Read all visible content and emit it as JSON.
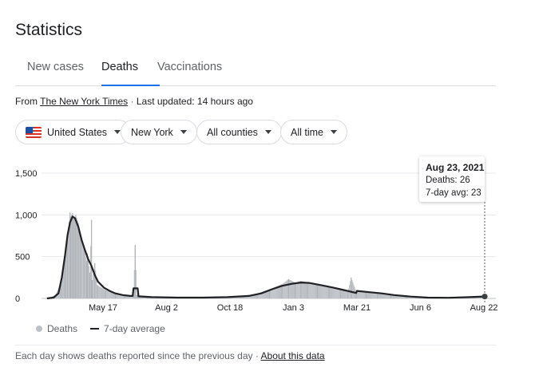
{
  "title": "Statistics",
  "tabs": [
    {
      "label": "New cases",
      "active": false
    },
    {
      "label": "Deaths",
      "active": true
    },
    {
      "label": "Vaccinations",
      "active": false
    }
  ],
  "source": {
    "prefix": "From",
    "link": "The New York Times",
    "separator": "·",
    "updated": "Last updated: 14 hours ago"
  },
  "filters": [
    {
      "label": "United States",
      "icon": "us-flag-icon"
    },
    {
      "label": "New York"
    },
    {
      "label": "All counties"
    },
    {
      "label": "All time"
    }
  ],
  "colors": {
    "accent": "#1a73e8",
    "bars": "#bdc1c6",
    "avg_line": "#202124"
  },
  "chart_data": {
    "type": "bar",
    "title": "",
    "ylim": [
      0,
      1500
    ],
    "yticks": [
      {
        "value": 0,
        "label": "0"
      },
      {
        "value": 500,
        "label": "500"
      },
      {
        "value": 1000,
        "label": "1,000"
      },
      {
        "value": 1500,
        "label": "1,500"
      }
    ],
    "xrange": [
      "2020-03-01",
      "2021-08-23"
    ],
    "xticks": [
      {
        "date": "2020-05-17",
        "label": "May 17"
      },
      {
        "date": "2020-08-02",
        "label": "Aug 2"
      },
      {
        "date": "2020-10-18",
        "label": "Oct 18"
      },
      {
        "date": "2021-01-03",
        "label": "Jan 3"
      },
      {
        "date": "2021-03-21",
        "label": "Mar 21"
      },
      {
        "date": "2021-06-06",
        "label": "Jun 6"
      },
      {
        "date": "2021-08-22",
        "label": "Aug 22"
      }
    ],
    "grid": "horizontal",
    "legend_position": "bottom-left",
    "legend": [
      "Deaths",
      "7-day average"
    ],
    "series": [
      {
        "name": "Deaths",
        "style": "bars",
        "points": [
          [
            "2020-03-10",
            0
          ],
          [
            "2020-03-20",
            40
          ],
          [
            "2020-03-27",
            180
          ],
          [
            "2020-04-01",
            480
          ],
          [
            "2020-04-04",
            700
          ],
          [
            "2020-04-07",
            1030
          ],
          [
            "2020-04-08",
            980
          ],
          [
            "2020-04-10",
            1020
          ],
          [
            "2020-04-12",
            960
          ],
          [
            "2020-04-14",
            1000
          ],
          [
            "2020-04-17",
            900
          ],
          [
            "2020-04-20",
            740
          ],
          [
            "2020-04-24",
            600
          ],
          [
            "2020-04-27",
            450
          ],
          [
            "2020-04-28",
            540
          ],
          [
            "2020-05-01",
            310
          ],
          [
            "2020-05-03",
            940
          ],
          [
            "2020-05-04",
            220
          ],
          [
            "2020-05-07",
            420
          ],
          [
            "2020-05-10",
            160
          ],
          [
            "2020-05-20",
            100
          ],
          [
            "2020-06-01",
            60
          ],
          [
            "2020-06-12",
            30
          ],
          [
            "2020-06-23",
            40
          ],
          [
            "2020-06-25",
            640
          ],
          [
            "2020-06-27",
            40
          ],
          [
            "2020-07-10",
            15
          ],
          [
            "2020-08-01",
            10
          ],
          [
            "2020-09-01",
            10
          ],
          [
            "2020-10-01",
            12
          ],
          [
            "2020-11-01",
            25
          ],
          [
            "2020-11-20",
            60
          ],
          [
            "2020-12-05",
            110
          ],
          [
            "2020-12-20",
            170
          ],
          [
            "2020-12-28",
            230
          ],
          [
            "2021-01-05",
            190
          ],
          [
            "2021-01-12",
            210
          ],
          [
            "2021-01-20",
            195
          ],
          [
            "2021-02-01",
            175
          ],
          [
            "2021-02-15",
            140
          ],
          [
            "2021-03-01",
            110
          ],
          [
            "2021-03-10",
            75
          ],
          [
            "2021-03-14",
            250
          ],
          [
            "2021-03-20",
            85
          ],
          [
            "2021-04-01",
            80
          ],
          [
            "2021-04-15",
            65
          ],
          [
            "2021-05-01",
            45
          ],
          [
            "2021-05-20",
            25
          ],
          [
            "2021-06-10",
            12
          ],
          [
            "2021-07-01",
            8
          ],
          [
            "2021-07-20",
            12
          ],
          [
            "2021-08-10",
            20
          ],
          [
            "2021-08-23",
            26
          ]
        ]
      },
      {
        "name": "7-day average",
        "style": "line",
        "points": [
          [
            "2020-03-10",
            0
          ],
          [
            "2020-03-18",
            10
          ],
          [
            "2020-03-24",
            60
          ],
          [
            "2020-03-28",
            250
          ],
          [
            "2020-04-01",
            520
          ],
          [
            "2020-04-04",
            760
          ],
          [
            "2020-04-07",
            910
          ],
          [
            "2020-04-10",
            980
          ],
          [
            "2020-04-13",
            960
          ],
          [
            "2020-04-17",
            860
          ],
          [
            "2020-04-21",
            700
          ],
          [
            "2020-04-25",
            580
          ],
          [
            "2020-04-29",
            470
          ],
          [
            "2020-05-03",
            390
          ],
          [
            "2020-05-07",
            280
          ],
          [
            "2020-05-11",
            200
          ],
          [
            "2020-05-18",
            130
          ],
          [
            "2020-05-25",
            90
          ],
          [
            "2020-06-01",
            60
          ],
          [
            "2020-06-10",
            40
          ],
          [
            "2020-06-19",
            30
          ],
          [
            "2020-06-22",
            30
          ],
          [
            "2020-06-23",
            120
          ],
          [
            "2020-06-28",
            120
          ],
          [
            "2020-06-29",
            25
          ],
          [
            "2020-07-15",
            15
          ],
          [
            "2020-08-15",
            10
          ],
          [
            "2020-09-15",
            10
          ],
          [
            "2020-10-15",
            15
          ],
          [
            "2020-11-10",
            30
          ],
          [
            "2020-11-25",
            60
          ],
          [
            "2020-12-08",
            110
          ],
          [
            "2020-12-20",
            150
          ],
          [
            "2021-01-01",
            175
          ],
          [
            "2021-01-12",
            190
          ],
          [
            "2021-01-22",
            185
          ],
          [
            "2021-02-05",
            160
          ],
          [
            "2021-02-20",
            130
          ],
          [
            "2021-03-05",
            100
          ],
          [
            "2021-03-20",
            65
          ],
          [
            "2021-03-21",
            90
          ],
          [
            "2021-04-05",
            75
          ],
          [
            "2021-04-20",
            60
          ],
          [
            "2021-05-05",
            40
          ],
          [
            "2021-05-25",
            22
          ],
          [
            "2021-06-15",
            10
          ],
          [
            "2021-07-10",
            8
          ],
          [
            "2021-08-01",
            14
          ],
          [
            "2021-08-23",
            23
          ]
        ]
      }
    ],
    "tooltip": {
      "date": "Aug 23, 2021",
      "deaths": "Deaths: 26",
      "avg": "7-day avg: 23"
    }
  },
  "footer": {
    "note": "Each day shows deaths reported since the previous day",
    "separator": "·",
    "link": "About this data"
  }
}
